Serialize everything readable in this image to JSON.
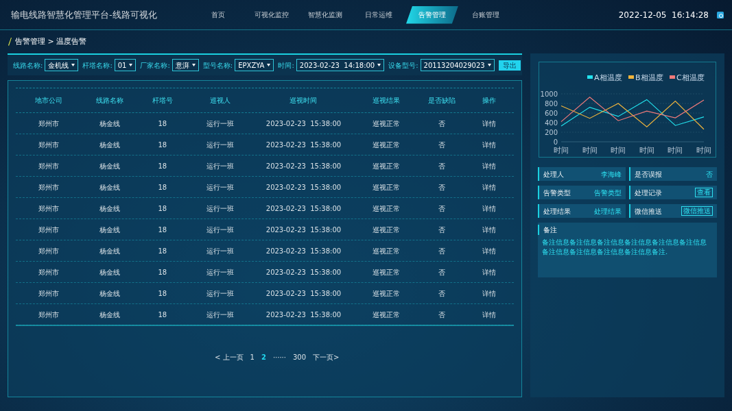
{
  "header": {
    "title": "输电线路智慧化管理平台-线路可视化",
    "datetime": "2022-12-05  16:14:28"
  },
  "nav": [
    {
      "label": "首页",
      "selected": false
    },
    {
      "label": "可视化监控",
      "selected": false
    },
    {
      "label": "智慧化监测",
      "selected": false
    },
    {
      "label": "日常运维",
      "selected": false
    },
    {
      "label": "告警管理",
      "selected": true
    },
    {
      "label": "台账管理",
      "selected": false
    }
  ],
  "breadcrumb": "告警管理 > 温度告警",
  "filters": [
    {
      "label": "线路名称:",
      "value": "金机线"
    },
    {
      "label": "杆塔名称:",
      "value": "01"
    },
    {
      "label": "厂家名称:",
      "value": "意湃"
    },
    {
      "label": "型号名称:",
      "value": "EPXZYA"
    },
    {
      "label": "时间:",
      "value": "2023-02-23  14:18:00"
    },
    {
      "label": "设备型号:",
      "value": "20113204029023"
    }
  ],
  "export_button": "导出",
  "table": {
    "columns": [
      "地市公司",
      "线路名称",
      "杆塔号",
      "巡视人",
      "巡视时间",
      "巡视结果",
      "是否缺陷",
      "操作"
    ],
    "rows": [
      [
        "郑州市",
        "杨金线",
        "18",
        "运行一班",
        "2023-02-23  15:38:00",
        "巡视正常",
        "否",
        "详情"
      ],
      [
        "郑州市",
        "杨金线",
        "18",
        "运行一班",
        "2023-02-23  15:38:00",
        "巡视正常",
        "否",
        "详情"
      ],
      [
        "郑州市",
        "杨金线",
        "18",
        "运行一班",
        "2023-02-23  15:38:00",
        "巡视正常",
        "否",
        "详情"
      ],
      [
        "郑州市",
        "杨金线",
        "18",
        "运行一班",
        "2023-02-23  15:38:00",
        "巡视正常",
        "否",
        "详情"
      ],
      [
        "郑州市",
        "杨金线",
        "18",
        "运行一班",
        "2023-02-23  15:38:00",
        "巡视正常",
        "否",
        "详情"
      ],
      [
        "郑州市",
        "杨金线",
        "18",
        "运行一班",
        "2023-02-23  15:38:00",
        "巡视正常",
        "否",
        "详情"
      ],
      [
        "郑州市",
        "杨金线",
        "18",
        "运行一班",
        "2023-02-23  15:38:00",
        "巡视正常",
        "否",
        "详情"
      ],
      [
        "郑州市",
        "杨金线",
        "18",
        "运行一班",
        "2023-02-23  15:38:00",
        "巡视正常",
        "否",
        "详情"
      ],
      [
        "郑州市",
        "杨金线",
        "18",
        "运行一班",
        "2023-02-23  15:38:00",
        "巡视正常",
        "否",
        "详情"
      ],
      [
        "郑州市",
        "杨金线",
        "18",
        "运行一班",
        "2023-02-23  15:38:00",
        "巡视正常",
        "否",
        "详情"
      ]
    ]
  },
  "pagination": [
    {
      "label": "< 上一页",
      "selected": false
    },
    {
      "label": "1",
      "selected": false
    },
    {
      "label": "2",
      "selected": true
    },
    {
      "label": "······",
      "selected": false
    },
    {
      "label": "300",
      "selected": false
    },
    {
      "label": "下一页>",
      "selected": false
    }
  ],
  "chart_data": {
    "type": "line",
    "grid": true,
    "legend": "top-right",
    "categories": [
      "时间",
      "时间",
      "时间",
      "时间",
      "时间",
      "时间"
    ],
    "ylim": [
      0,
      1000
    ],
    "yticks": [
      0,
      200,
      400,
      600,
      800,
      1000
    ],
    "series": [
      {
        "name": "A相温度",
        "color": "#22e3ee",
        "values": [
          330,
          720,
          530,
          880,
          340,
          520
        ]
      },
      {
        "name": "B相温度",
        "color": "#f0b43c",
        "values": [
          750,
          490,
          800,
          310,
          850,
          260
        ]
      },
      {
        "name": "C相温度",
        "color": "#f07a7a",
        "values": [
          420,
          930,
          440,
          640,
          500,
          870
        ]
      }
    ]
  },
  "details": [
    {
      "kind": "text",
      "label": "处理人",
      "value": "李海峰"
    },
    {
      "kind": "text",
      "label": "是否误报",
      "value": "否"
    },
    {
      "kind": "text",
      "label": "告警类型",
      "value": "告警类型"
    },
    {
      "kind": "button",
      "label": "处理记录",
      "value": "查看"
    },
    {
      "kind": "text",
      "label": "处理结果",
      "value": "处理结果"
    },
    {
      "kind": "button",
      "label": "微信推送",
      "value": "微信推送"
    }
  ],
  "remark": {
    "label": "备注",
    "text": "备注信息备注信息备注信息备注信息备注信息备注信息备注信息备注信息备注信息备注信息备注."
  }
}
